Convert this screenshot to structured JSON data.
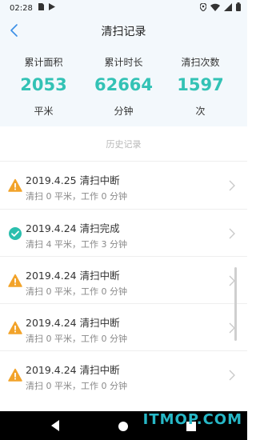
{
  "status_bar": {
    "time": "02:28"
  },
  "header": {
    "title": "清扫记录"
  },
  "stats": [
    {
      "label": "累计面积",
      "value": "2053",
      "unit": "平米"
    },
    {
      "label": "累计时长",
      "value": "62664",
      "unit": "分钟"
    },
    {
      "label": "清扫次数",
      "value": "1597",
      "unit": "次"
    }
  ],
  "history": {
    "section_title": "历史记录",
    "items": [
      {
        "status_icon": "warning-icon",
        "title": "2019.4.25 清扫中断",
        "detail": "清扫 0 平米，工作 0 分钟"
      },
      {
        "status_icon": "check-icon",
        "title": "2019.4.24 清扫完成",
        "detail": "清扫 4 平米，工作 3 分钟"
      },
      {
        "status_icon": "warning-icon",
        "title": "2019.4.24 清扫中断",
        "detail": "清扫 0 平米，工作 0 分钟"
      },
      {
        "status_icon": "warning-icon",
        "title": "2019.4.24 清扫中断",
        "detail": "清扫 0 平米，工作 0 分钟"
      },
      {
        "status_icon": "warning-icon",
        "title": "2019.4.24 清扫中断",
        "detail": "清扫 0 平米，工作 0 分钟"
      }
    ]
  },
  "colors": {
    "accent": "#33c2b5",
    "warning": "#f2a32a",
    "success": "#2bbfae",
    "header_bg": "#f3f8fc"
  },
  "watermark": "ITMOP.COM"
}
